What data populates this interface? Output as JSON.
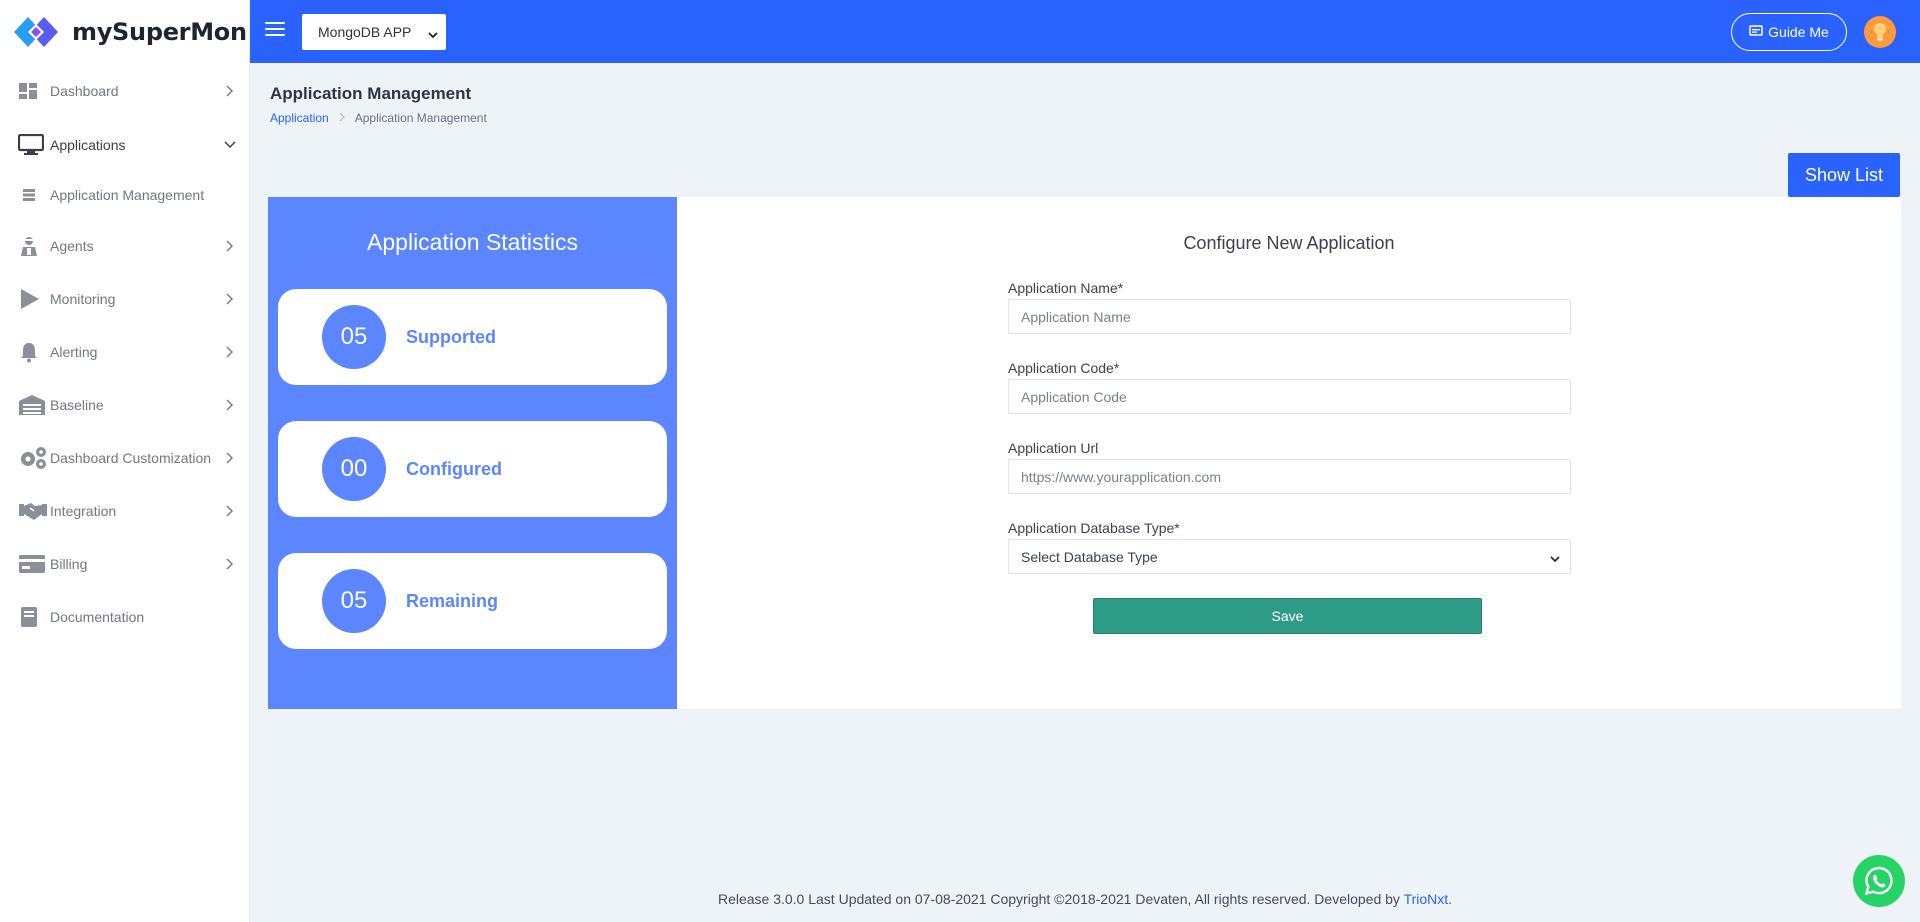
{
  "brand": {
    "name": "mySuperMon"
  },
  "colors": {
    "primary": "#2962ff",
    "stats_bg": "#5b86ff",
    "save": "#2e9b86",
    "whatsapp": "#25d366"
  },
  "header": {
    "app_selector": "MongoDB APP",
    "guide_label": "Guide Me"
  },
  "sidebar": {
    "items": [
      {
        "label": "Dashboard",
        "icon": "dashboard-icon",
        "has_chevron": true
      },
      {
        "label": "Applications",
        "icon": "monitor-icon",
        "has_chevron": true,
        "expanded": true
      },
      {
        "label": "Agents",
        "icon": "agent-icon",
        "has_chevron": true
      },
      {
        "label": "Monitoring",
        "icon": "play-icon",
        "has_chevron": true
      },
      {
        "label": "Alerting",
        "icon": "bell-icon",
        "has_chevron": true
      },
      {
        "label": "Baseline",
        "icon": "warehouse-icon",
        "has_chevron": true
      },
      {
        "label": "Dashboard Customization",
        "icon": "gears-icon",
        "has_chevron": true
      },
      {
        "label": "Integration",
        "icon": "handshake-icon",
        "has_chevron": true
      },
      {
        "label": "Billing",
        "icon": "credit-card-icon",
        "has_chevron": true
      },
      {
        "label": "Documentation",
        "icon": "book-icon",
        "has_chevron": false
      }
    ],
    "sub_item": {
      "label": "Application Management",
      "icon": "server-icon"
    }
  },
  "page": {
    "title": "Application Management",
    "breadcrumb": {
      "root": "Application",
      "current": "Application Management"
    },
    "show_list": "Show List"
  },
  "stats": {
    "title": "Application Statistics",
    "cards": [
      {
        "value": "05",
        "label": "Supported"
      },
      {
        "value": "00",
        "label": "Configured"
      },
      {
        "value": "05",
        "label": "Remaining"
      }
    ]
  },
  "form": {
    "title": "Configure New Application",
    "name_label": "Application Name*",
    "name_placeholder": "Application Name",
    "code_label": "Application Code*",
    "code_placeholder": "Application Code",
    "url_label": "Application Url",
    "url_placeholder": "https://www.yourapplication.com",
    "db_label": "Application Database Type*",
    "db_selected": "Select Database Type",
    "save_label": "Save"
  },
  "footer": {
    "text": "Release 3.0.0 Last Updated on 07-08-2021 Copyright ©2018-2021 Devaten, All rights reserved. Developed by",
    "developer": "TrioNxt",
    "period": "."
  }
}
